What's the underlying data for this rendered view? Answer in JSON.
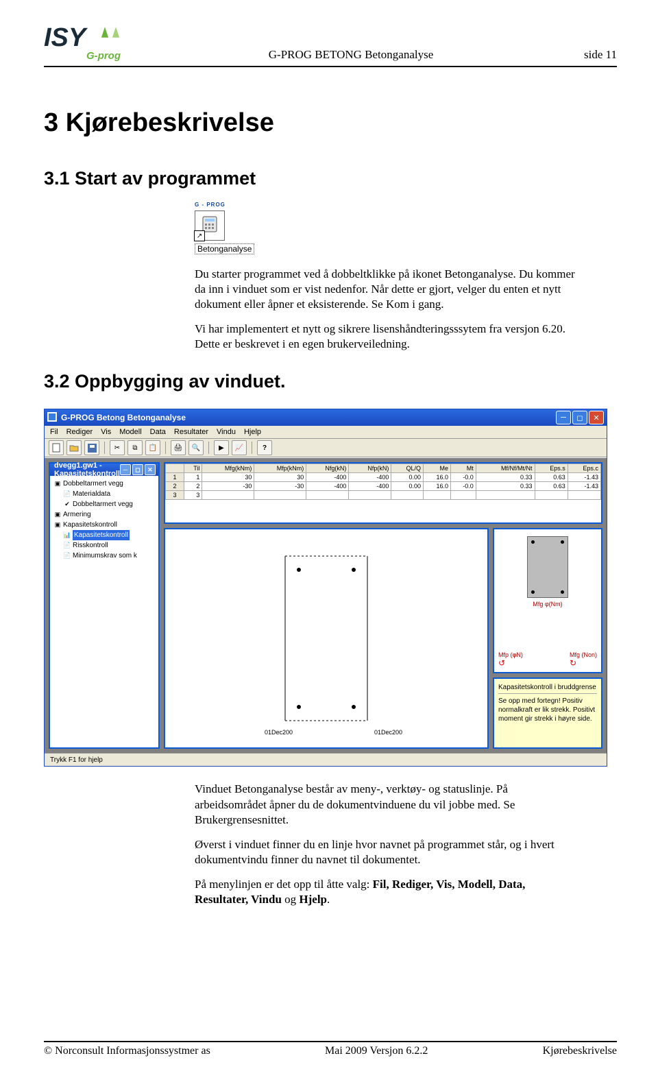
{
  "header": {
    "center": "G-PROG BETONG Betonganalyse",
    "right": "side 11"
  },
  "logo": {
    "text": "ISY",
    "sub": "G-prog"
  },
  "h1": "3  Kjørebeskrivelse",
  "h2_1": "3.1 Start av programmet",
  "shortcut": {
    "badge": "G - PROG",
    "label": "Betonganalyse"
  },
  "para1": "Du starter programmet ved å dobbeltklikke på ikonet Betonganalyse. Du kommer da inn i vinduet som er vist nedenfor. Når dette er gjort, velger du enten et nytt dokument eller åpner et eksisterende. Se Kom i gang.",
  "para2": "Vi har implementert et nytt og sikrere lisenshåndteringsssytem fra versjon 6.20. Dette er beskrevet i en egen brukerveiledning.",
  "h2_2": "3.2 Oppbygging av vinduet.",
  "app": {
    "title": "G-PROG Betong Betonganalyse",
    "menus": [
      "Fil",
      "Rediger",
      "Vis",
      "Modell",
      "Data",
      "Resultater",
      "Vindu",
      "Hjelp"
    ],
    "sub_title": "dvegg1.gw1 - Kapasitetskontroll",
    "tree": [
      {
        "lvl": 0,
        "icon": "▣",
        "label": "Dobbeltarmert vegg"
      },
      {
        "lvl": 1,
        "icon": "📄",
        "label": "Materialdata"
      },
      {
        "lvl": 1,
        "icon": "✔",
        "label": "Dobbeltarmert vegg"
      },
      {
        "lvl": 0,
        "icon": "▣",
        "label": "Armering"
      },
      {
        "lvl": 0,
        "icon": "▣",
        "label": "Kapasitetskontroll"
      },
      {
        "lvl": 1,
        "icon": "📊",
        "label": "Kapasitetskontroll",
        "selected": true
      },
      {
        "lvl": 1,
        "icon": "📄",
        "label": "Risskontroll"
      },
      {
        "lvl": 1,
        "icon": "📄",
        "label": "Minimumskrav som k"
      }
    ],
    "grid": {
      "headers": [
        "Til",
        "Mfg(kNm)",
        "Mfp(kNm)",
        "Nfg(kN)",
        "Nfp(kN)",
        "QL/Q",
        "Me",
        "Mt",
        "Mf/Nf/Mt/Nt",
        "Eps.s",
        "Eps.c"
      ],
      "rows": [
        [
          "1",
          "30",
          "30",
          "-400",
          "-400",
          "0.00",
          "16.0",
          "-0.0",
          "0.33",
          "0.63",
          "-1.43"
        ],
        [
          "2",
          "-30",
          "-30",
          "-400",
          "-400",
          "0.00",
          "16.0",
          "-0.0",
          "0.33",
          "0.63",
          "-1.43"
        ],
        [
          "3",
          "",
          "",
          "",
          "",
          "",
          "",
          "",
          "",
          "",
          ""
        ]
      ]
    },
    "section_labels": {
      "mtop": "Mfg φ(Nm)",
      "mleft": "Mfp (φN)",
      "mright": "Mfg (Non)"
    },
    "info": {
      "title": "Kapasitetskontroll i bruddgrense",
      "body": "Se opp med fortegn! Positiv normalkraft er lik strekk. Positivt moment gir strekk i høyre side."
    },
    "status": "Trykk F1 for hjelp"
  },
  "para3": "Vinduet Betonganalyse består av meny-, verktøy- og statuslinje. På arbeidsområdet åpner du de dokumentvinduene du vil jobbe med. Se Brukergrensesnittet.",
  "para4": "Øverst i vinduet finner du en linje hvor navnet på programmet står, og i hvert dokumentvindu finner du navnet til dokumentet.",
  "para5_a": "På menylinjen er det opp til åtte valg: ",
  "para5_b": "Fil, Rediger, Vis, Modell, Data, Resultater, Vindu",
  "para5_c": " og ",
  "para5_d": "Hjelp",
  "para5_e": ".",
  "footer": {
    "left": "© Norconsult Informasjonssystmer as",
    "center": "Mai 2009 Versjon 6.2.2",
    "right": "Kjørebeskrivelse"
  }
}
